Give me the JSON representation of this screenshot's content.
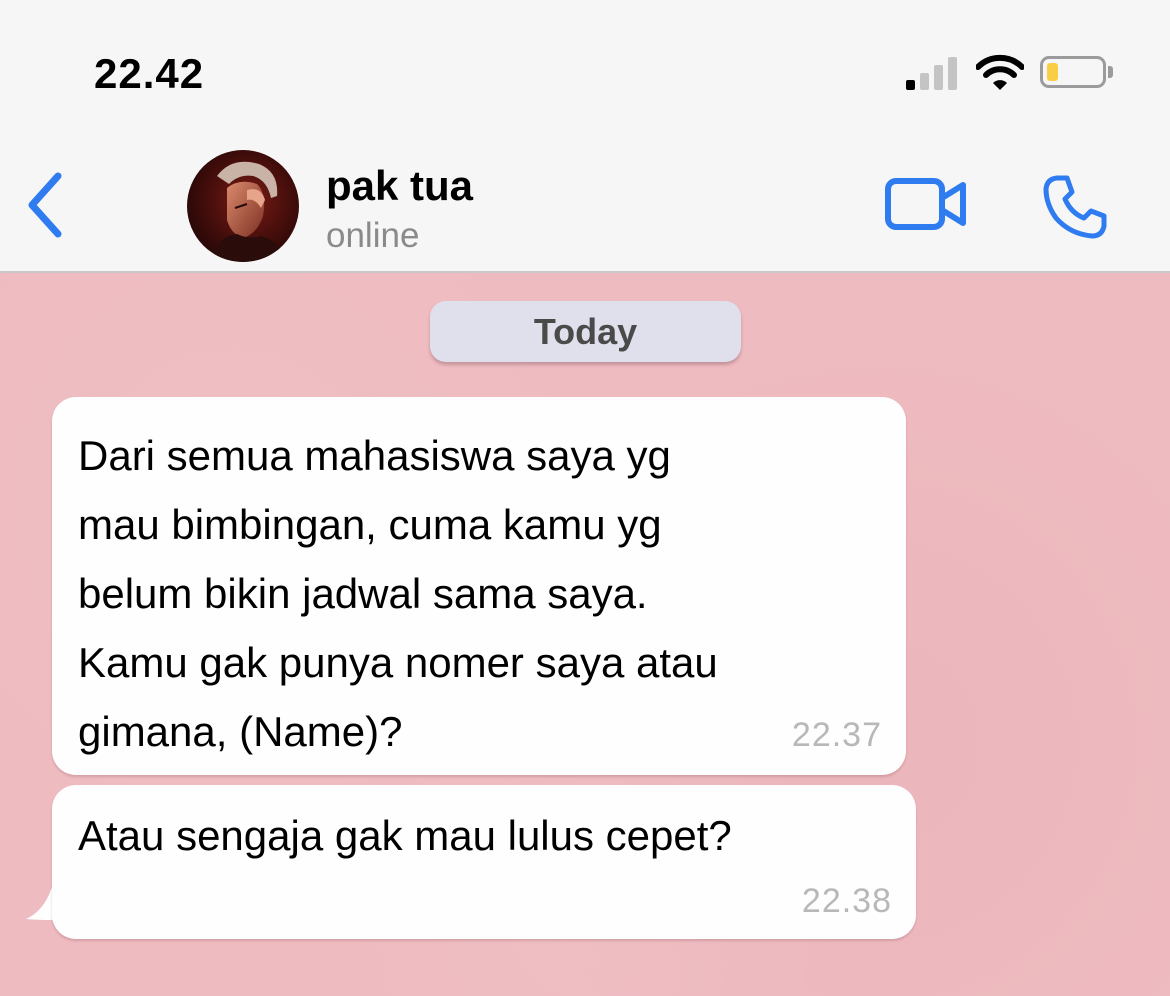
{
  "status_bar": {
    "time": "22.42",
    "signal_icon": "cellular-signal-icon",
    "wifi_icon": "wifi-icon",
    "battery_icon": "battery-low-icon",
    "battery_level": 0.2,
    "battery_color": "#f7ce46"
  },
  "header": {
    "back_icon": "chevron-left-icon",
    "contact_name": "pak tua",
    "contact_status": "online",
    "video_call_icon": "video-camera-icon",
    "voice_call_icon": "phone-icon",
    "accent_color": "#2f7cf0"
  },
  "chat": {
    "background_color": "#eebbc0",
    "date_separator": "Today",
    "messages": [
      {
        "text": "Dari semua mahasiswa saya yg\nmau bimbingan, cuma kamu yg\nbelum bikin jadwal sama saya.\nKamu gak punya nomer saya atau\ngimana, (Name)?",
        "time": "22.37"
      },
      {
        "text": "Atau sengaja gak mau lulus cepet?",
        "time": "22.38"
      }
    ]
  }
}
